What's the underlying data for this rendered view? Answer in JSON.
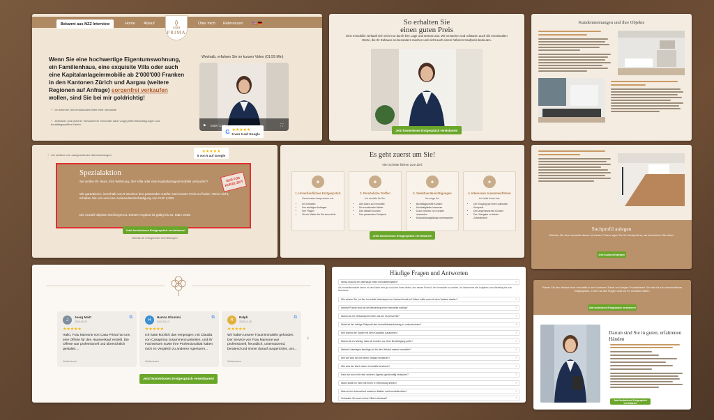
{
  "hero": {
    "nzz_label": "Bekannt aus NZZ Interview",
    "nav": {
      "home": "Home",
      "ablauf": "Ablauf",
      "about": "Über mich",
      "refs": "Referenzen",
      "langs": "🇺🇸 🇩🇪"
    },
    "logo_top": "casa",
    "logo_bottom": "PRIMA",
    "headline_start": "Wenn Sie eine hochwertige Eigentumswohnung, ein Familienhaus, eine exquisite Villa oder auch eine Kapitalanlageimmobilie ab 2'000'000 Franken in den Kantonen Zürich und Aargau (weitere Regionen auf Anfrage) ",
    "headline_link": "sorgenfrei verkaufen",
    "headline_end": " wollen, sind Sie bei mir goldrichtig!",
    "bullets": [
      "Ich erkenne den emotionalen Wert Ihrer Immobilie",
      "Zeitnaher und sicherer Verkauf Ihrer Immobilie dank vorgeprüfter Besichtigungen und bonitätsgeprüfter Käufer",
      "Ich schütze vor unangenehmen Überraschungen"
    ],
    "video_caption": "Weshalb, erfahren Sie im kurzen Video (01:59 Min)",
    "video_time": "0:00 / 1:59",
    "rating_label": "5 von 5 auf Google",
    "stars": "★★★★★"
  },
  "price": {
    "title_line1": "So erhalten Sie",
    "title_line2": "einen guten Preis",
    "intro": "Eine Immobilie verkauft sich nicht nur durch ihre Lage und Grösse aus. Wir verstehen und schätzen auch die emotionalen Werte, die Ihr Zuhause so besonders machen und nicht auch einem höheren Kaufpreis bedeuten.",
    "cta": "Jetzt kostenloses Erstgespräch vereinbaren!"
  },
  "clients": {
    "title": "Kundenmeinungen und ihre Objekte"
  },
  "special": {
    "top_line": "Ich schütze vor unangenehmen Überraschungen",
    "google_label": "5 von 5 auf Google",
    "title": "Spezialaktion",
    "p1": "Sie wollen Ihr Haus, Ihre Wohnung, Ihre Villa oder eine Kapitalanlageimmobilie verkaufen?",
    "p2": "Wir garantieren, innerhalb von 8 Wochen den passenden Käufer zum besten Preis zu finden. Wenn nicht, erhalten Sie von uns eine Aufwandsentschädigung von CHF 3,000.",
    "p3": "Die Anzahl Objekte sind begrenzt. Dieses Angebot ist gültig bis 31. März 2025.",
    "stamp": "NUR FÜR KURZE ZEIT",
    "cta": "Jetzt kostenloses Erstgespräch vereinbaren!",
    "sub": "Bereits 50 erfolgreiche Vermittlungen"
  },
  "steps": {
    "title": "Es geht zuerst um Sie!",
    "subtitle": "Vier Schritte führen zum Ziel:",
    "items": [
      {
        "title": "1. Unverbindliches Erstgespräch",
        "desc": "Gemeinsam besprechen wir:",
        "points": [
          "Ihr Vorhaben",
          "Ihre wichtigen Anfragen",
          "Ihre Fragen",
          "Ob ein Makler für Sie sinnvoll ist"
        ]
      },
      {
        "title": "2. Persönliche Treffen",
        "desc": "Ich ermittle für Sie:",
        "points": [
          "Alle Daten zur Immobilie",
          "Die emotionalen Werte",
          "Den idealen Kunden",
          "Den passenden Kaufpreis"
        ]
      },
      {
        "title": "3. Selektive Besichtigungen",
        "desc": "Ich zeige Ihr:",
        "points": [
          "Bonitätsgeprüfte Kunden",
          "Nichtmitglieder Interesse",
          "Durch reichen von Kunden auswerten",
          "Entscheidungsfähige Interessenten"
        ]
      },
      {
        "title": "4. Interessen zusammenführen",
        "desc": "Ich helfe Ihnen bei:",
        "points": [
          "Der Eingang auf einen optimalen Kaufpreis",
          "Den angemessenen Kunden",
          "Der Übergabe zu beider Zufriedenheit"
        ]
      }
    ],
    "cta": "Jetzt kostenloses Erstgespräch vereinbaren!"
  },
  "profile": {
    "title": "Suchprofil anlegen",
    "text": "Möchten Sie eine Immobilie dieser Art kaufen? Dann legen Sie Ihr Suchprofil an, wir informieren Sie sofort.",
    "cta": "Jetzt Suchprofil anlegen"
  },
  "reviews": {
    "items": [
      {
        "initial": "J",
        "name": "Joerg Maitt",
        "date": "2024-05-22",
        "text": "Hallo, Frau Mamone von Casa Prima hat uns eine Offerte für den Hausverkauf erstellt. Die Offerte war professionell und übersichtlich gestaltet....",
        "more": "Weiterlesen"
      },
      {
        "initial": "H",
        "name": "Hamza Ghunimi",
        "date": "2024-03-12",
        "text": "Ich hatte kürzlich das Vergnügen, mit Claudia von Casaprima zusammenzuarbeiten, und ihr Fachwissen sowie ihre Professionalität haben mich im Vergleich zu anderen Agenturen...",
        "more": "Weiterlesen"
      },
      {
        "initial": "R",
        "name": "Ralph",
        "date": "2023-11-28",
        "text": "Wir haben unsere Traumimmobilie gefunden. Der Service von Frau Mamone war professionell, freundlich, unterstützend, beratend und immer darauf ausgerichtet, uns...",
        "more": "Weiterlesen"
      }
    ],
    "stars": "★★★★★",
    "google": "G",
    "cta": "Jetzt kostenloses Erstgespräch vereinbaren!"
  },
  "faq": {
    "title": "Häufige Fragen und Antworten",
    "questions": [
      "Wieso braucht ich überhaupt einen Immobilienmakler?",
      "Wie wissen Sie, ob Ihre Immobilie überhaupt zum Verkauf bereit ist? Wann sollte man mit dem Verkauf starten?",
      "Welche Punkte sind bei der Bewertung einer Immobilie wichtig?",
      "Warum ist Ihr Verkaufspreis höher als der Durchschnitt?",
      "Wann ist der richtige Zeitpunkt den Immobilienkaufvertrag zu unterzeichnen?",
      "Wie kommt der Käufer mit dem Kaufpreis zusammen?",
      "Warum ist es wichtig, dass ich Kunden vor einer Besichtigung prüfe?",
      "Welche Unterlagen benötige ich für den Verkauf meiner Immobilie?",
      "Wie viel wird ich mit einem Verkauf verdienen?",
      "Wie wird der Wert meiner Immobilie bestimmt?",
      "Kann ich auch mit einer anderen Agentur gleichzeitig verkaufen?",
      "Wann sollte ich mich mit Ihnen in Verbindung setzen?",
      "Was ist der Unterschied zwischen Makler und Immobilienbüro?",
      "Verkaufen Sie auch meine Villa im Ausland?"
    ],
    "answer": "Als Immobilienmakler kenne ich den Markt sehr gut und kann Ihnen helfen, den besten Preis für Ihre Immobilie zu erzielen. Ich übernehme alle Aufgaben vom Marketing bis zum Abschluss."
  },
  "about": {
    "cta": "Jetzt kostenloses Erstgespräch vereinbaren!",
    "banner": "Planen Sie den Verkauf einer Immobilie in den Kantonen Zürich und Aargau? Kontaktieren Sie mich für ein unverbindliches Erstgespräch, in dem wir alle Fragen rund um Ihr Vorhaben klären.",
    "title_line1": "Darum sind Sie in guten, erfahrenen",
    "title_line2": "Händen",
    "cta2": "Jetzt kostenloses Erstgespräch vereinbaren!"
  },
  "colors": {
    "accent": "#b08a63",
    "cta": "#6aa62a",
    "stamp": "#e03030",
    "background": "#6f4e35"
  }
}
